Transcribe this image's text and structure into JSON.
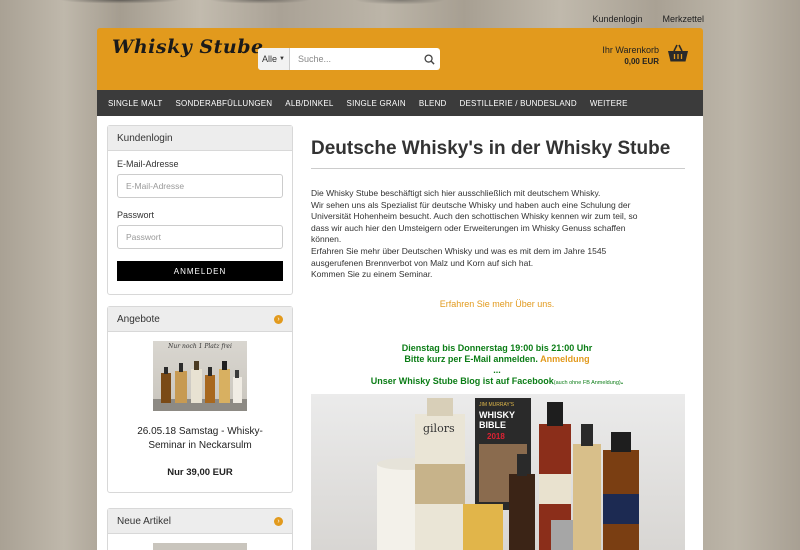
{
  "top_links": {
    "login": "Kundenlogin",
    "wishlist": "Merkzettel"
  },
  "header": {
    "logo": "Whisky Stube",
    "search_scope": "Alle",
    "search_placeholder": "Suche...",
    "cart_label": "Ihr Warenkorb",
    "cart_amount": "0,00 EUR"
  },
  "nav": {
    "items": [
      "SINGLE MALT",
      "SONDERABFÜLLUNGEN",
      "ALB/DINKEL",
      "SINGLE GRAIN",
      "BLEND",
      "DESTILLERIE / BUNDESLAND",
      "WEITERE"
    ]
  },
  "login_box": {
    "title": "Kundenlogin",
    "email_label": "E-Mail-Adresse",
    "email_placeholder": "E-Mail-Adresse",
    "password_label": "Passwort",
    "password_placeholder": "Passwort",
    "submit": "ANMELDEN"
  },
  "offers_box": {
    "title": "Angebote",
    "image_caption": "Nur noch 1 Platz frei",
    "item_title": "26.05.18 Samstag - Whisky-Seminar in Neckarsulm",
    "price": "Nur 39,00 EUR"
  },
  "new_box": {
    "title": "Neue Artikel"
  },
  "main": {
    "title": "Deutsche Whisky's in der Whisky Stube",
    "intro_lines": [
      "Die Whisky Stube beschäftigt sich hier ausschließlich mit deutschem Whisky.",
      "Wir sehen uns als Spezialist für deutsche Whisky und haben auch eine Schulung der",
      "Universität Hohenheim besucht. Auch den schottischen Whisky kennen wir zum teil, so",
      "dass wir auch hier den Umsteigern oder Erweiterungen im Whisky Genuss schaffen",
      "können.",
      "Erfahren Sie mehr über Deutschen Whisky und was es mit dem im Jahre 1545",
      "ausgerufenen Brennverbot von Malz und Korn auf sich hat.",
      "Kommen Sie zu einem Seminar."
    ],
    "more_link": "Erfahren Sie mehr Über uns.",
    "seminar_line1": "Dienstag bis Donnerstag 19:00 bis 21:00 Uhr",
    "seminar_line2": "Bitte kurz per E-Mail anmelden.",
    "seminar_line2_link": "Anmeldung",
    "seminar_dots": "...",
    "blog_line": "Unser Whisky Stube Blog ist auf Facebook",
    "blog_small": "(auch ohne FB Anmeldung)",
    "blog_end": ".",
    "photo_labels": {
      "brand1": "gilors",
      "book_title": "WHISKY BIBLE",
      "book_author": "JIM MURRAY'S",
      "book_year": "2018"
    }
  },
  "colors": {
    "accent": "#e29a1d",
    "nav_bg": "#3b3b3b",
    "green": "#0b7d16"
  }
}
